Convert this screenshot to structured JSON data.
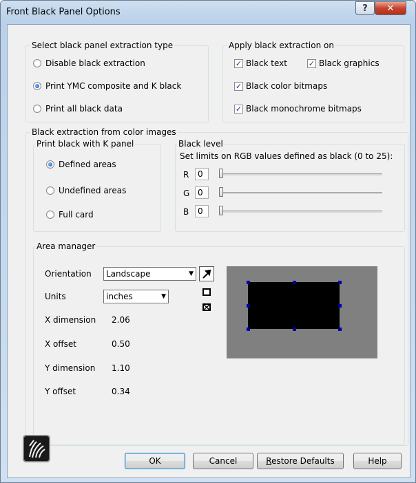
{
  "window": {
    "title": "Front Black Panel Options",
    "help_glyph": "?",
    "close_glyph": "✕"
  },
  "extraction_type": {
    "legend": "Select black panel extraction type",
    "options": [
      {
        "label": "Disable black extraction",
        "selected": false
      },
      {
        "label": "Print YMC composite and K black",
        "selected": true
      },
      {
        "label": "Print all black data",
        "selected": false
      }
    ]
  },
  "apply_on": {
    "legend": "Apply black extraction on",
    "options": [
      {
        "label": "Black text",
        "checked": true
      },
      {
        "label": "Black graphics",
        "checked": true
      },
      {
        "label": "Black color bitmaps",
        "checked": true
      },
      {
        "label": "Black monochrome bitmaps",
        "checked": true
      }
    ]
  },
  "color_images": {
    "legend": "Black extraction from color images",
    "k_panel": {
      "legend": "Print black with K panel",
      "options": [
        {
          "label": "Defined areas",
          "selected": true
        },
        {
          "label": "Undefined areas",
          "selected": false
        },
        {
          "label": "Full card",
          "selected": false
        }
      ]
    },
    "black_level": {
      "legend": "Black level",
      "description": "Set limits on RGB values defined as black (0 to 25):",
      "channels": [
        {
          "label": "R",
          "value": "0"
        },
        {
          "label": "G",
          "value": "0"
        },
        {
          "label": "B",
          "value": "0"
        }
      ]
    },
    "area_manager": {
      "legend": "Area manager",
      "orientation_label": "Orientation",
      "orientation_value": "Landscape",
      "units_label": "Units",
      "units_value": "inches",
      "x_dimension_label": "X dimension",
      "x_dimension_value": "2.06",
      "x_offset_label": "X offset",
      "x_offset_value": "0.50",
      "y_dimension_label": "Y dimension",
      "y_dimension_value": "1.10",
      "y_offset_label": "Y offset",
      "y_offset_value": "0.34",
      "tools": [
        "select-arrow-icon",
        "rectangle-icon",
        "delete-area-icon"
      ]
    }
  },
  "buttons": {
    "ok": "OK",
    "cancel": "Cancel",
    "restore_first": "R",
    "restore_rest": "estore Defaults",
    "help": "Help"
  },
  "colors": {
    "preview_bg": "#808080",
    "area_fill": "#000000",
    "handle": "#0000a0",
    "check": "#1f3e8c"
  }
}
